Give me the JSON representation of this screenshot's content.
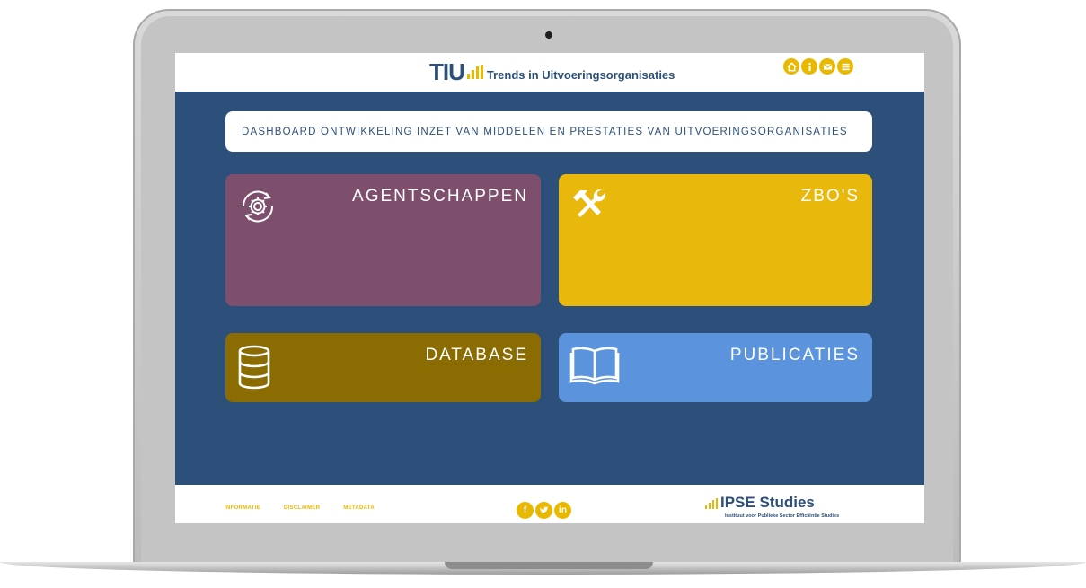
{
  "header": {
    "logo_abbr": "TIU",
    "logo_text": "Trends in Uitvoeringsorganisaties",
    "icons": [
      "home-icon",
      "info-icon",
      "mail-icon",
      "menu-icon"
    ]
  },
  "title_bar": {
    "text": "DASHBOARD ONTWIKKELING INZET VAN MIDDELEN EN PRESTATIES VAN UITVOERINGSORGANISATIES"
  },
  "tiles": [
    {
      "label": "AGENTSCHAPPEN",
      "icon": "gear-cycle-icon",
      "color": "#7d4f6d"
    },
    {
      "label": "ZBO'S",
      "icon": "tools-icon",
      "color": "#e9b80d"
    },
    {
      "label": "DATABASE",
      "icon": "database-icon",
      "color": "#8a6c02"
    },
    {
      "label": "PUBLICATIES",
      "icon": "book-icon",
      "color": "#5b94dc"
    }
  ],
  "footer": {
    "links": [
      "INFORMATIE",
      "DISCLAIMER",
      "METADATA"
    ],
    "social": [
      "facebook-icon",
      "twitter-icon",
      "linkedin-icon"
    ],
    "org_name": "IPSE Studies",
    "org_subtitle": "Instituut voor Publieke Sector Efficiëntie Studies"
  },
  "colors": {
    "background": "#2c5079",
    "accent": "#e9b800"
  }
}
